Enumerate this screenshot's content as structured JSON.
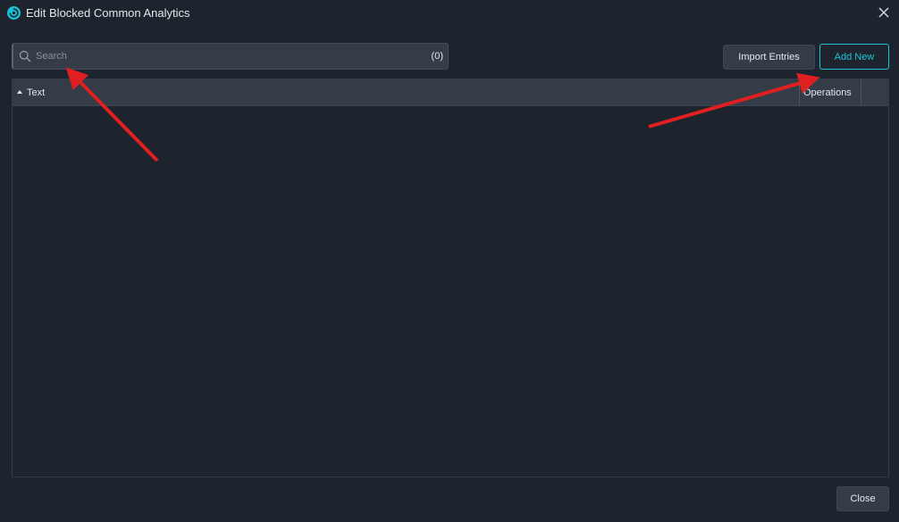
{
  "window": {
    "title": "Edit Blocked Common Analytics",
    "app_icon": "app-logo-icon",
    "close_icon": "close-icon"
  },
  "search": {
    "placeholder": "Search",
    "value": "",
    "count": "(0)",
    "icon": "search-icon"
  },
  "toolbar": {
    "import_label": "Import Entries",
    "add_label": "Add New"
  },
  "table": {
    "columns": [
      {
        "label": "Text",
        "sort": "ascending"
      },
      {
        "label": "Operations"
      }
    ],
    "rows": []
  },
  "footer": {
    "close_label": "Close"
  },
  "colors": {
    "background": "#1e242e",
    "panel": "#343c48",
    "accent": "#19c4d9",
    "annotation": "#e02020"
  }
}
